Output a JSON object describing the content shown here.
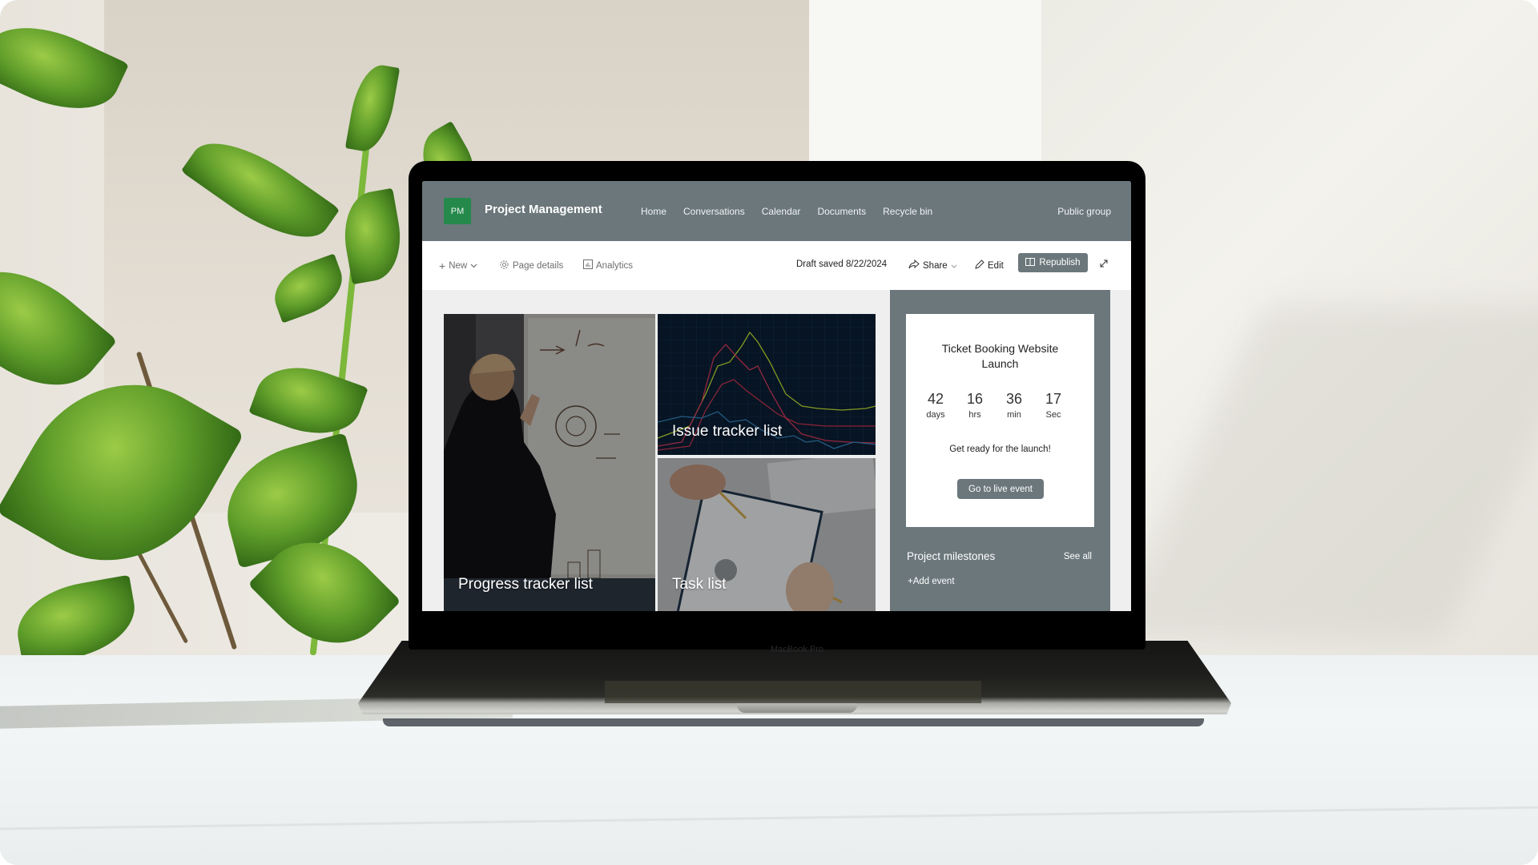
{
  "app": {
    "logo_initials": "PM",
    "title": "Project Management",
    "logo_color": "#26894c",
    "header_color": "#6b777b"
  },
  "nav": {
    "items": [
      "Home",
      "Conversations",
      "Calendar",
      "Documents",
      "Recycle bin"
    ],
    "group_type": "Public group"
  },
  "toolbar": {
    "new_label": "New",
    "page_details_label": "Page details",
    "analytics_label": "Analytics",
    "draft_status": "Draft saved 8/22/2024",
    "share_label": "Share",
    "edit_label": "Edit",
    "republish_label": "Republish"
  },
  "tiles": [
    {
      "label": "Progress tracker list"
    },
    {
      "label": "Issue tracker list"
    },
    {
      "label": "Task list"
    }
  ],
  "countdown": {
    "title": "Ticket Booking  Website Launch",
    "units": [
      {
        "value": "42",
        "unit": "days"
      },
      {
        "value": "16",
        "unit": "hrs"
      },
      {
        "value": "36",
        "unit": "min"
      },
      {
        "value": "17",
        "unit": "Sec"
      }
    ],
    "message": "Get ready for the launch!",
    "button_label": "Go to live event"
  },
  "milestones": {
    "title": "Project milestones",
    "see_all_label": "See all",
    "add_label": "Add event"
  },
  "device": {
    "brand_label": "MacBook Pro"
  }
}
